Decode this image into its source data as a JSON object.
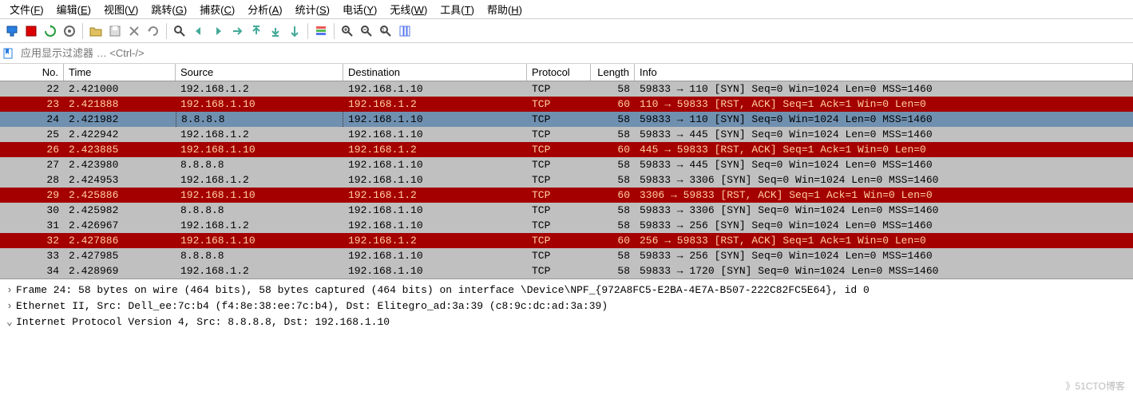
{
  "menu": [
    "文件(F)",
    "编辑(E)",
    "视图(V)",
    "跳转(G)",
    "捕获(C)",
    "分析(A)",
    "统计(S)",
    "电话(Y)",
    "无线(W)",
    "工具(T)",
    "帮助(H)"
  ],
  "filter_placeholder": "应用显示过滤器 … <Ctrl-/>",
  "columns": [
    "No.",
    "Time",
    "Source",
    "Destination",
    "Protocol",
    "Length",
    "Info"
  ],
  "rows": [
    {
      "no": "22",
      "time": "2.421000",
      "src": "192.168.1.2",
      "dst": "192.168.1.10",
      "proto": "TCP",
      "len": "58",
      "info": "59833 → 110 [SYN] Seq=0 Win=1024 Len=0 MSS=1460",
      "cls": "gray"
    },
    {
      "no": "23",
      "time": "2.421888",
      "src": "192.168.1.10",
      "dst": "192.168.1.2",
      "proto": "TCP",
      "len": "60",
      "info": "110 → 59833 [RST, ACK] Seq=1 Ack=1 Win=0 Len=0",
      "cls": "red"
    },
    {
      "no": "24",
      "time": "2.421982",
      "src": "8.8.8.8",
      "dst": "192.168.1.10",
      "proto": "TCP",
      "len": "58",
      "info": "59833 → 110 [SYN] Seq=0 Win=1024 Len=0 MSS=1460",
      "cls": "sel"
    },
    {
      "no": "25",
      "time": "2.422942",
      "src": "192.168.1.2",
      "dst": "192.168.1.10",
      "proto": "TCP",
      "len": "58",
      "info": "59833 → 445 [SYN] Seq=0 Win=1024 Len=0 MSS=1460",
      "cls": "gray"
    },
    {
      "no": "26",
      "time": "2.423885",
      "src": "192.168.1.10",
      "dst": "192.168.1.2",
      "proto": "TCP",
      "len": "60",
      "info": "445 → 59833 [RST, ACK] Seq=1 Ack=1 Win=0 Len=0",
      "cls": "red"
    },
    {
      "no": "27",
      "time": "2.423980",
      "src": "8.8.8.8",
      "dst": "192.168.1.10",
      "proto": "TCP",
      "len": "58",
      "info": "59833 → 445 [SYN] Seq=0 Win=1024 Len=0 MSS=1460",
      "cls": "gray"
    },
    {
      "no": "28",
      "time": "2.424953",
      "src": "192.168.1.2",
      "dst": "192.168.1.10",
      "proto": "TCP",
      "len": "58",
      "info": "59833 → 3306 [SYN] Seq=0 Win=1024 Len=0 MSS=1460",
      "cls": "gray"
    },
    {
      "no": "29",
      "time": "2.425886",
      "src": "192.168.1.10",
      "dst": "192.168.1.2",
      "proto": "TCP",
      "len": "60",
      "info": "3306 → 59833 [RST, ACK] Seq=1 Ack=1 Win=0 Len=0",
      "cls": "red"
    },
    {
      "no": "30",
      "time": "2.425982",
      "src": "8.8.8.8",
      "dst": "192.168.1.10",
      "proto": "TCP",
      "len": "58",
      "info": "59833 → 3306 [SYN] Seq=0 Win=1024 Len=0 MSS=1460",
      "cls": "gray"
    },
    {
      "no": "31",
      "time": "2.426967",
      "src": "192.168.1.2",
      "dst": "192.168.1.10",
      "proto": "TCP",
      "len": "58",
      "info": "59833 → 256 [SYN] Seq=0 Win=1024 Len=0 MSS=1460",
      "cls": "gray"
    },
    {
      "no": "32",
      "time": "2.427886",
      "src": "192.168.1.10",
      "dst": "192.168.1.2",
      "proto": "TCP",
      "len": "60",
      "info": "256 → 59833 [RST, ACK] Seq=1 Ack=1 Win=0 Len=0",
      "cls": "red"
    },
    {
      "no": "33",
      "time": "2.427985",
      "src": "8.8.8.8",
      "dst": "192.168.1.10",
      "proto": "TCP",
      "len": "58",
      "info": "59833 → 256 [SYN] Seq=0 Win=1024 Len=0 MSS=1460",
      "cls": "gray"
    },
    {
      "no": "34",
      "time": "2.428969",
      "src": "192.168.1.2",
      "dst": "192.168.1.10",
      "proto": "TCP",
      "len": "58",
      "info": "59833 → 1720 [SYN] Seq=0 Win=1024 Len=0 MSS=1460",
      "cls": "gray"
    }
  ],
  "details": [
    "Frame 24: 58 bytes on wire (464 bits), 58 bytes captured (464 bits) on interface \\Device\\NPF_{972A8FC5-E2BA-4E7A-B507-222C82FC5E64}, id 0",
    "Ethernet II, Src: Dell_ee:7c:b4 (f4:8e:38:ee:7c:b4), Dst: Elitegro_ad:3a:39 (c8:9c:dc:ad:3a:39)",
    "Internet Protocol Version 4, Src: 8.8.8.8, Dst: 192.168.1.10"
  ],
  "watermark": "》51CTO博客"
}
